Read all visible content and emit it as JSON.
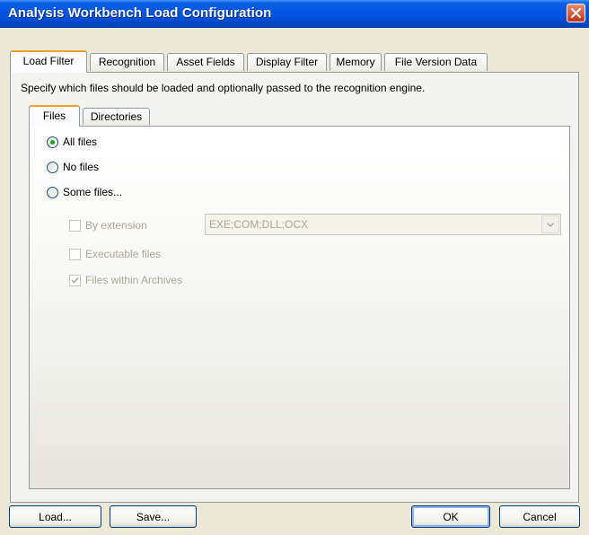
{
  "window": {
    "title": "Analysis Workbench Load Configuration"
  },
  "tabs": [
    "Load Filter",
    "Recognition",
    "Asset Fields",
    "Display Filter",
    "Memory",
    "File Version Data"
  ],
  "description": "Specify which files should be loaded and optionally passed to the recognition engine.",
  "subtabs": [
    "Files",
    "Directories"
  ],
  "radios": [
    {
      "label": "All files",
      "checked": true
    },
    {
      "label": "No files",
      "checked": false
    },
    {
      "label": "Some files...",
      "checked": false
    }
  ],
  "options": {
    "by_extension": {
      "label": "By extension",
      "checked": false
    },
    "executable": {
      "label": "Executable files",
      "checked": false
    },
    "archives": {
      "label": "Files within Archives",
      "checked": true
    },
    "extension_value": "EXE;COM;DLL;OCX"
  },
  "buttons": {
    "load": "Load...",
    "save": "Save...",
    "ok": "OK",
    "cancel": "Cancel"
  },
  "colors": {
    "title_bar": "#0054e3",
    "active_tab_accent": "#f0a030",
    "radio_dot": "#21a121",
    "close_button": "#c2351b"
  }
}
